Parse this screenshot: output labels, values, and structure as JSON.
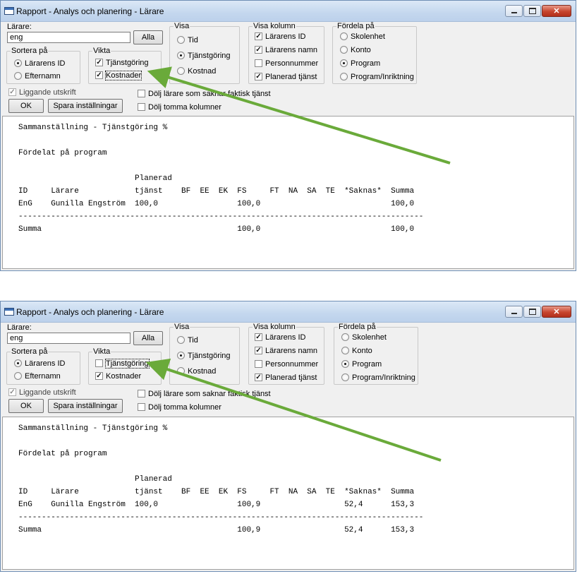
{
  "colors": {
    "arrow": "#6aaa3a",
    "window_border": "#6f8eb4"
  },
  "windows": [
    {
      "title": "Rapport - Analys och planering - Lärare",
      "teacher_label": "Lärare:",
      "teacher_value": "eng",
      "all_button": "Alla",
      "sort_group": {
        "label": "Sortera på",
        "options": [
          "Lärarens ID",
          "Efternamn"
        ],
        "selected": "Lärarens ID"
      },
      "weight_group": {
        "label": "Vikta",
        "service": {
          "label": "Tjänstgöring",
          "checked": true
        },
        "costs": {
          "label": "Kostnader",
          "checked": true
        }
      },
      "landscape": {
        "label": "Liggande utskrift",
        "checked": true
      },
      "ok_button": "OK",
      "save_button": "Spara inställningar",
      "hide_no_actual": {
        "label": "Dölj lärare som saknar faktisk tjänst",
        "checked": false
      },
      "hide_empty_cols": {
        "label": "Dölj tomma kolumner",
        "checked": false
      },
      "show_group": {
        "label": "Visa",
        "options": [
          "Tid",
          "Tjänstgöring",
          "Kostnad"
        ],
        "selected": "Tjänstgöring"
      },
      "columns_group": {
        "label": "Visa kolumn",
        "options": [
          {
            "label": "Lärarens ID",
            "checked": true
          },
          {
            "label": "Lärarens namn",
            "checked": true
          },
          {
            "label": "Personnummer",
            "checked": false
          },
          {
            "label": "Planerad tjänst",
            "checked": true
          }
        ]
      },
      "distribute_group": {
        "label": "Fördela på",
        "options": [
          "Skolenhet",
          "Konto",
          "Program",
          "Program/Inriktning"
        ],
        "selected": "Program"
      },
      "report": {
        "heading": "Sammanställning - Tjänstgöring %",
        "subheading": "Fördelat på program",
        "header_top": "Planerad",
        "columns": [
          "ID",
          "Lärare",
          "tjänst",
          "BF",
          "EE",
          "EK",
          "FS",
          "FT",
          "NA",
          "SA",
          "TE",
          "*Saknas*",
          "Summa"
        ],
        "rows": [
          {
            "ID": "EnG",
            "Lärare": "Gunilla Engström",
            "tjänst": "100,0",
            "FS": "100,0",
            "*Saknas*": "",
            "Summa": "100,0"
          }
        ],
        "separator": "---------------------------------------------------------------------------------------",
        "total": {
          "label": "Summa",
          "FS": "100,0",
          "*Saknas*": "",
          "Summa": "100,0"
        }
      }
    },
    {
      "title": "Rapport - Analys och planering - Lärare",
      "teacher_label": "Lärare:",
      "teacher_value": "eng",
      "all_button": "Alla",
      "sort_group": {
        "label": "Sortera på",
        "options": [
          "Lärarens ID",
          "Efternamn"
        ],
        "selected": "Lärarens ID"
      },
      "weight_group": {
        "label": "Vikta",
        "service": {
          "label": "Tjänstgöring",
          "checked": false
        },
        "costs": {
          "label": "Kostnader",
          "checked": true
        }
      },
      "landscape": {
        "label": "Liggande utskrift",
        "checked": true
      },
      "ok_button": "OK",
      "save_button": "Spara inställningar",
      "hide_no_actual": {
        "label": "Dölj lärare som saknar faktisk tjänst",
        "checked": false
      },
      "hide_empty_cols": {
        "label": "Dölj tomma kolumner",
        "checked": false
      },
      "show_group": {
        "label": "Visa",
        "options": [
          "Tid",
          "Tjänstgöring",
          "Kostnad"
        ],
        "selected": "Tjänstgöring"
      },
      "columns_group": {
        "label": "Visa kolumn",
        "options": [
          {
            "label": "Lärarens ID",
            "checked": true
          },
          {
            "label": "Lärarens namn",
            "checked": true
          },
          {
            "label": "Personnummer",
            "checked": false
          },
          {
            "label": "Planerad tjänst",
            "checked": true
          }
        ]
      },
      "distribute_group": {
        "label": "Fördela på",
        "options": [
          "Skolenhet",
          "Konto",
          "Program",
          "Program/Inriktning"
        ],
        "selected": "Program"
      },
      "report": {
        "heading": "Sammanställning - Tjänstgöring %",
        "subheading": "Fördelat på program",
        "header_top": "Planerad",
        "columns": [
          "ID",
          "Lärare",
          "tjänst",
          "BF",
          "EE",
          "EK",
          "FS",
          "FT",
          "NA",
          "SA",
          "TE",
          "*Saknas*",
          "Summa"
        ],
        "rows": [
          {
            "ID": "EnG",
            "Lärare": "Gunilla Engström",
            "tjänst": "100,0",
            "FS": "100,9",
            "*Saknas*": "52,4",
            "Summa": "153,3"
          }
        ],
        "separator": "---------------------------------------------------------------------------------------",
        "total": {
          "label": "Summa",
          "FS": "100,9",
          "*Saknas*": "52,4",
          "Summa": "153,3"
        }
      }
    }
  ]
}
